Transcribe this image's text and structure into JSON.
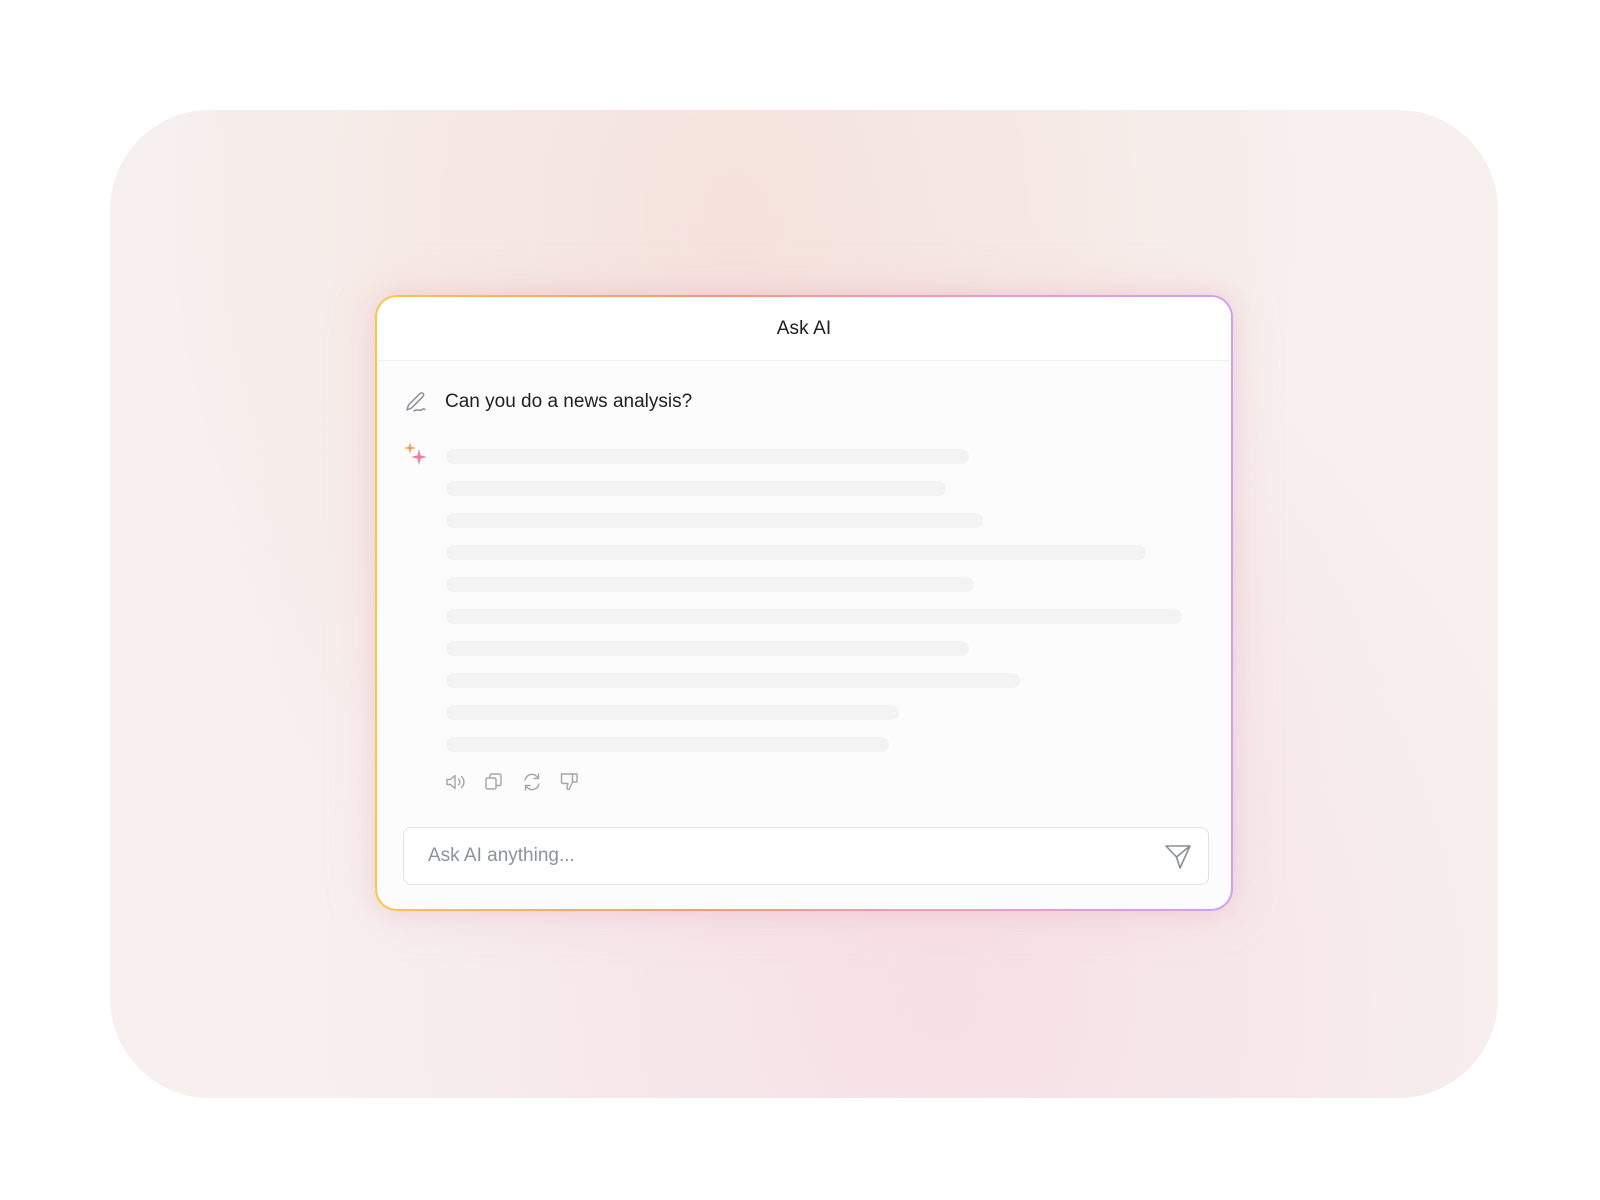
{
  "dialog": {
    "title": "Ask AI"
  },
  "conversation": {
    "user_prompt": "Can you do a news analysis?",
    "response_state": "loading"
  },
  "response_actions": [
    {
      "icon": "speaker-icon",
      "name": "read-aloud"
    },
    {
      "icon": "copy-icon",
      "name": "copy"
    },
    {
      "icon": "refresh-icon",
      "name": "regenerate"
    },
    {
      "icon": "thumbs-down-icon",
      "name": "dislike"
    }
  ],
  "composer": {
    "placeholder": "Ask AI anything...",
    "value": "",
    "send_icon": "send-icon"
  },
  "colors": {
    "border_gradient": [
      "#f7c74a",
      "#f59a7c",
      "#f29bb7",
      "#c9a3ef"
    ],
    "sparkle_orange": "#f0a053",
    "sparkle_pink": "#ec7ea3",
    "skeleton": "#f3f3f3",
    "icon_gray": "#9a9ca3"
  }
}
